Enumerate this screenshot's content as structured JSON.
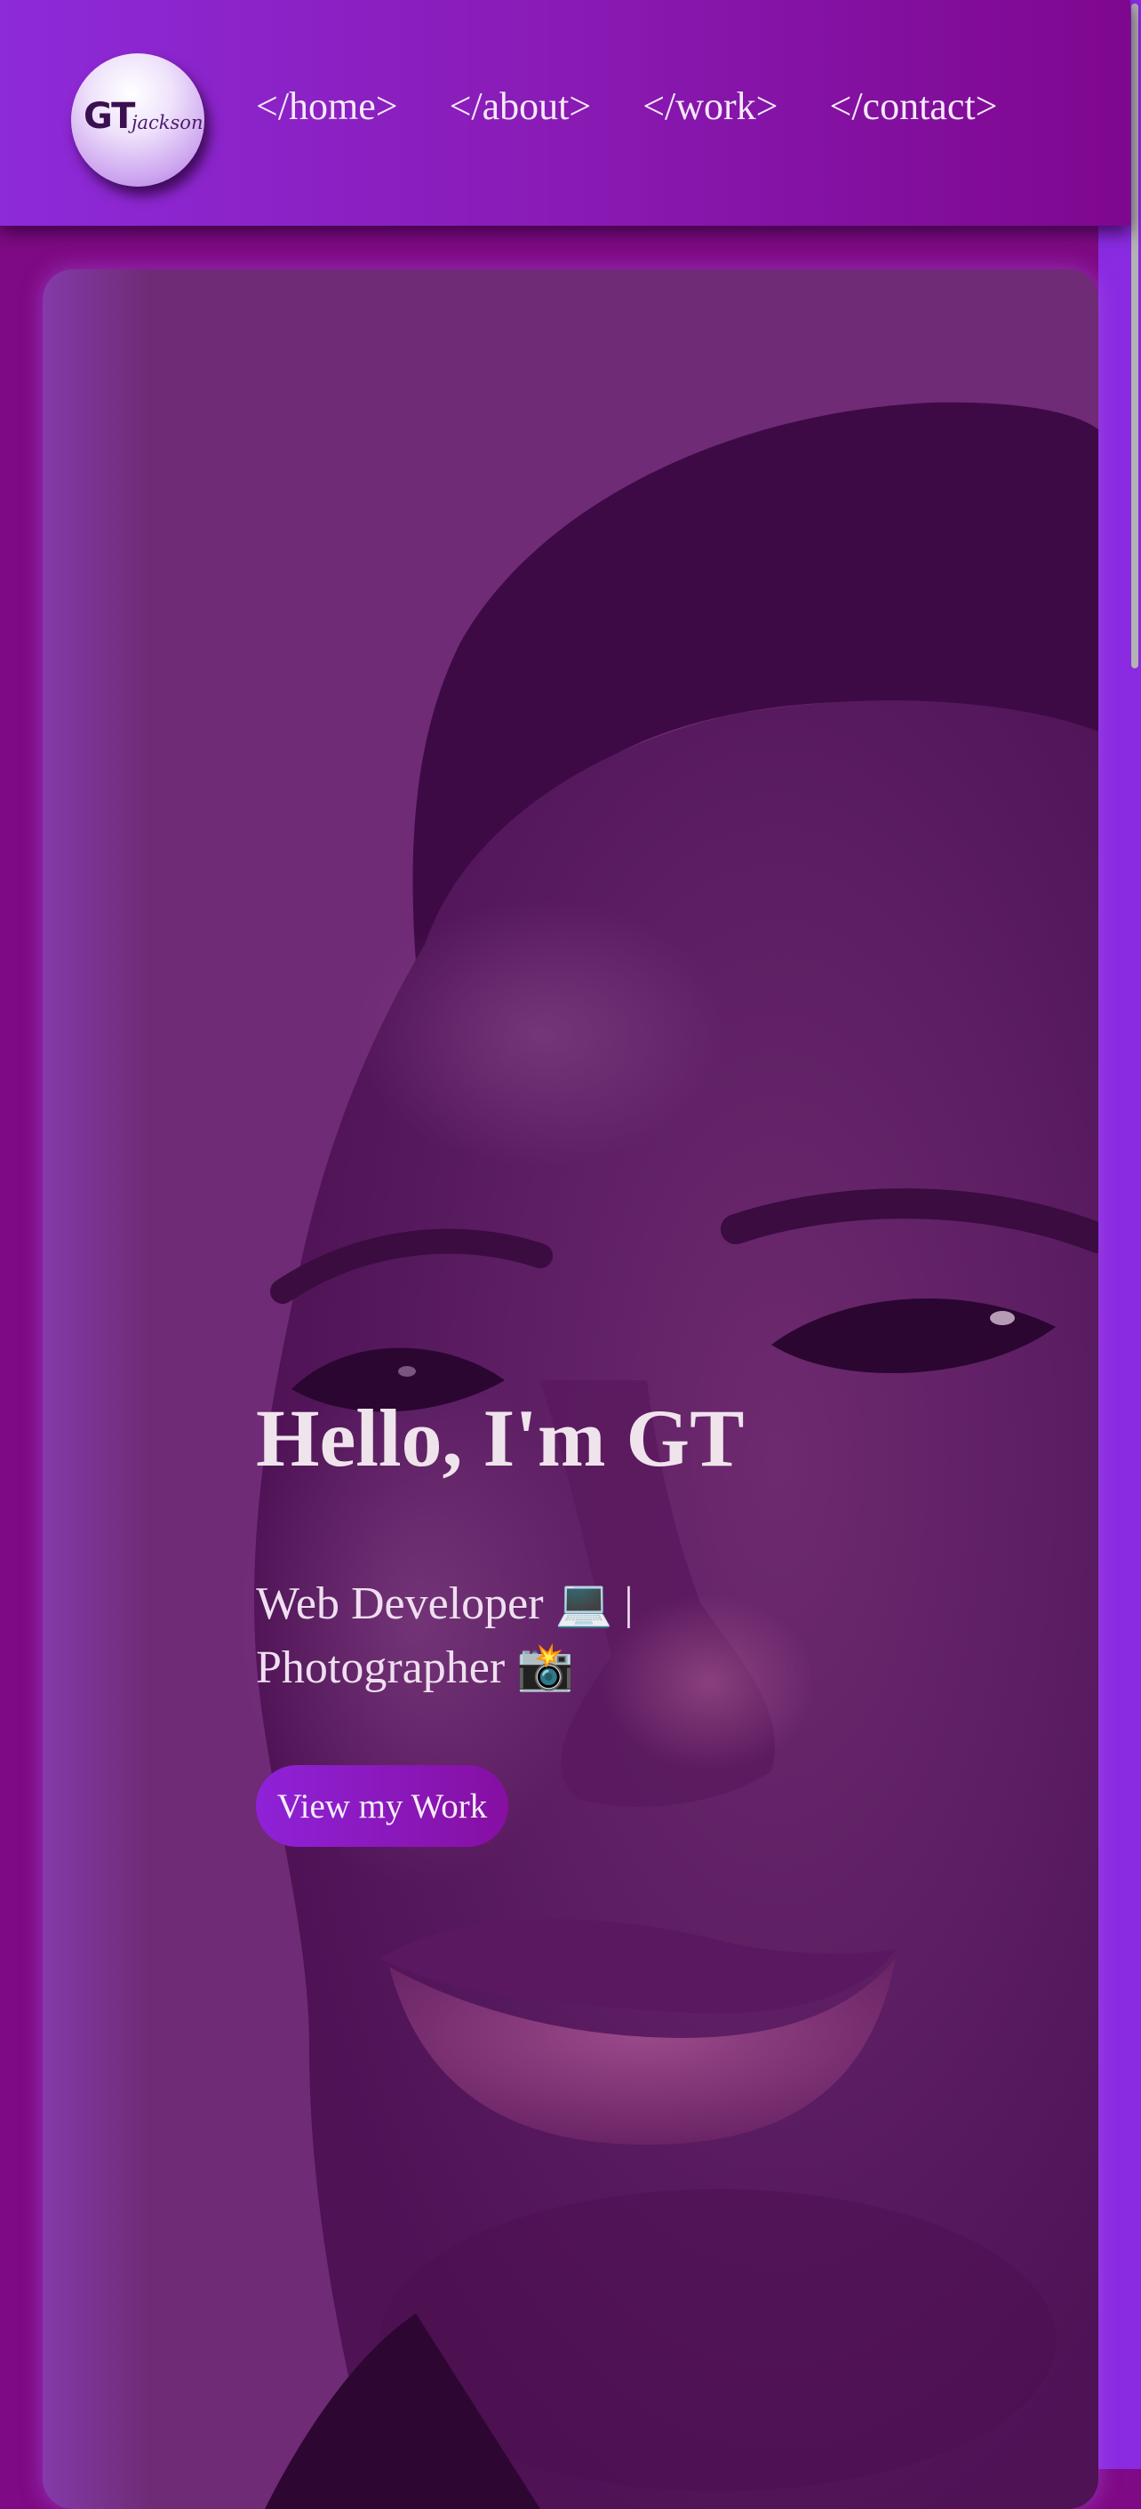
{
  "logo": {
    "main": "GT",
    "sub": "jackson"
  },
  "nav": {
    "items": [
      {
        "label": "</home>"
      },
      {
        "label": "</about>"
      },
      {
        "label": "</work>"
      },
      {
        "label": "</contact>"
      }
    ]
  },
  "hero": {
    "title": "Hello, I'm GT",
    "subtitle": "Web Developer 💻 | Photographer 📸",
    "cta_label": "View my Work",
    "background_image": "portrait-photo"
  },
  "colors": {
    "page_background": "#7f0a85",
    "header_gradient_start": "#8d2ad9",
    "header_gradient_end": "#7f078f",
    "accent_stripe": "#8a2be2",
    "button_gradient_start": "#8f22d8",
    "button_gradient_end": "#860fa2",
    "text_light": "#f0e4ec"
  }
}
